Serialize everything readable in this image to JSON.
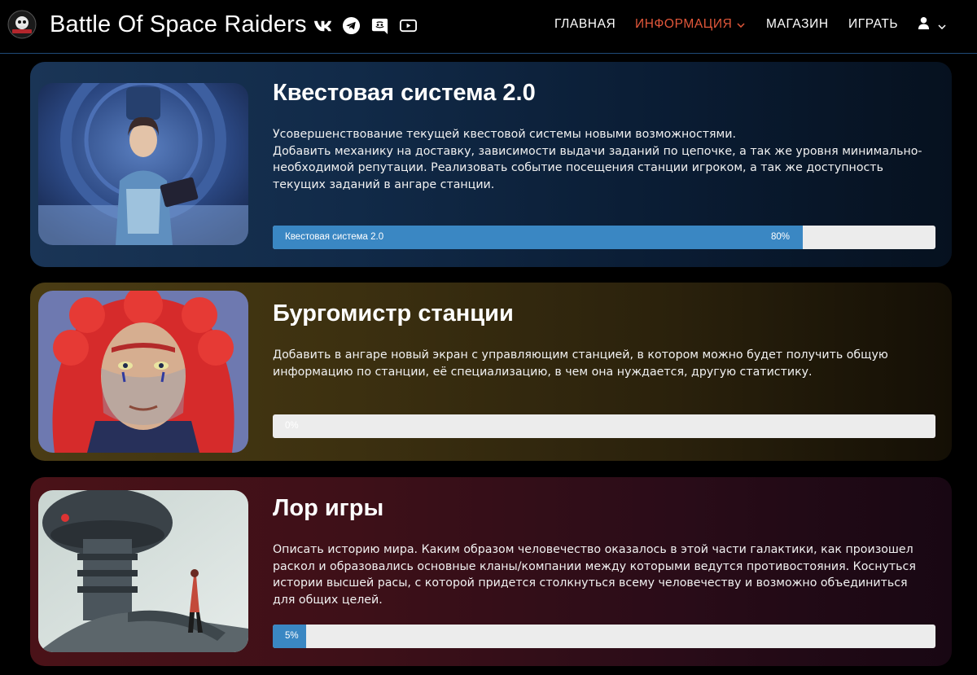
{
  "header": {
    "brand": "Battle Of Space Raiders",
    "socials": [
      {
        "icon": "vk-icon"
      },
      {
        "icon": "telegram-icon"
      },
      {
        "icon": "discord-icon"
      },
      {
        "icon": "youtube-icon"
      }
    ],
    "nav": {
      "home": "ГЛАВНАЯ",
      "info": "ИНФОРМАЦИЯ",
      "shop": "МАГАЗИН",
      "play": "ИГРАТЬ"
    },
    "active_color": "#e2573a"
  },
  "cards": [
    {
      "title": "Квестовая система 2.0",
      "desc": [
        "Усовершенствование текущей квестовой системы новыми возможностями.",
        "Добавить механику на доставку, зависимости выдачи заданий по цепочке, а так же уровня минимально-необходимой репутации. Реализовать событие посещения станции игроком, а так же доступность текущих заданий в ангаре станции."
      ],
      "progress_label": "Квестовая система 2.0",
      "progress_pct_text": "80%",
      "progress_value": 0.8
    },
    {
      "title": "Бургомистр станции",
      "desc": [
        "Добавить в ангаре новый экран с управляющим станцией, в котором можно будет получить общую информацию по станции, её специализацию, в чем она нуждается, другую статистику."
      ],
      "progress_label": "",
      "progress_pct_text": "0%",
      "progress_value": 0.0
    },
    {
      "title": "Лор игры",
      "desc": [
        "Описать историю мира. Каким образом человечество оказалось в этой части галактики, как произошел раскол и образовались основные кланы/компании между которыми ведутся противостояния. Коснуться истории высшей расы, с которой придется столкнуться всему человечеству и возможно объединиться для общих целей."
      ],
      "progress_label": "",
      "progress_pct_text": "5%",
      "progress_value": 0.05
    }
  ],
  "colors": {
    "progress_fill": "#3a87c3",
    "progress_track": "#ececec"
  }
}
